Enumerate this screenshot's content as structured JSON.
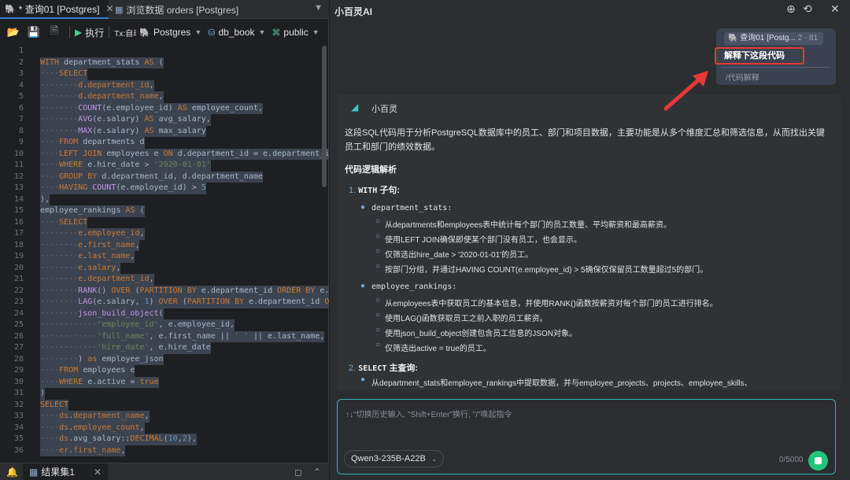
{
  "tabs": [
    {
      "label": "* 查询01 [Postgres]",
      "close": "✕"
    },
    {
      "label": "浏览数据 orders [Postgres]"
    }
  ],
  "toolbar": {
    "execute": "执行",
    "tx": "Tx:自动",
    "connection": "Postgres",
    "database": "db_book",
    "schema": "public"
  },
  "editor": {
    "line_numbers": [
      "1",
      "2",
      "3",
      "4",
      "5",
      "6",
      "7",
      "8",
      "9",
      "10",
      "11",
      "12",
      "13",
      "14",
      "15",
      "16",
      "17",
      "18",
      "19",
      "20",
      "21",
      "22",
      "23",
      "24",
      "25",
      "26",
      "27",
      "28",
      "29",
      "30",
      "31",
      "32",
      "33",
      "34",
      "35",
      "36"
    ]
  },
  "bottom": {
    "result_tab": "结果集1"
  },
  "ai_panel": {
    "title": "小百灵AI",
    "context_chip": "查询01 [Postg...",
    "context_range": "2 - 81",
    "explain_option": "解释下这段代码",
    "slash_command": "/代码解释",
    "bot_name": "小百灵",
    "intro": "这段SQL代码用于分析PostgreSQL数据库中的员工、部门和项目数据，主要功能是从多个维度汇总和筛选信息，从而找出关键员工和部门的绩效数据。",
    "section_title": "代码逻辑解析",
    "item1_num": "1.",
    "item1_code": "WITH",
    "item1_text": " 子句:",
    "dept_stats_label": "department_stats:",
    "dept_points": [
      "从departments和employees表中统计每个部门的员工数量、平均薪资和最高薪资。",
      "使用LEFT JOIN确保即使某个部门没有员工，也会显示。",
      "仅筛选出hire_date > '2020-01-01'的员工。",
      "按部门分组，并通过HAVING COUNT(e.employee_id) > 5确保仅保留员工数量超过5的部门。"
    ],
    "emp_rank_label": "employee_rankings:",
    "emp_points": [
      "从employees表中获取员工的基本信息，并使用RANK()函数按薪资对每个部门的员工进行排名。",
      "使用LAG()函数获取员工之前入职的员工薪资。",
      "使用json_build_object创建包含员工信息的JSON对象。",
      "仅筛选出active = true的员工。"
    ],
    "item2_num": "2.",
    "item2_code": "SELECT",
    "item2_text": " 主查询:",
    "item2_point": "从department_stats和employee_rankings中提取数据，并与employee_projects、projects、employee_skills、",
    "input_placeholder": "↑↓\"切换历史输入, \"Shift+Enter\"换行, \"/\"唤起指令",
    "model": "Qwen3-235B-A22B",
    "counter": "0/5000"
  }
}
